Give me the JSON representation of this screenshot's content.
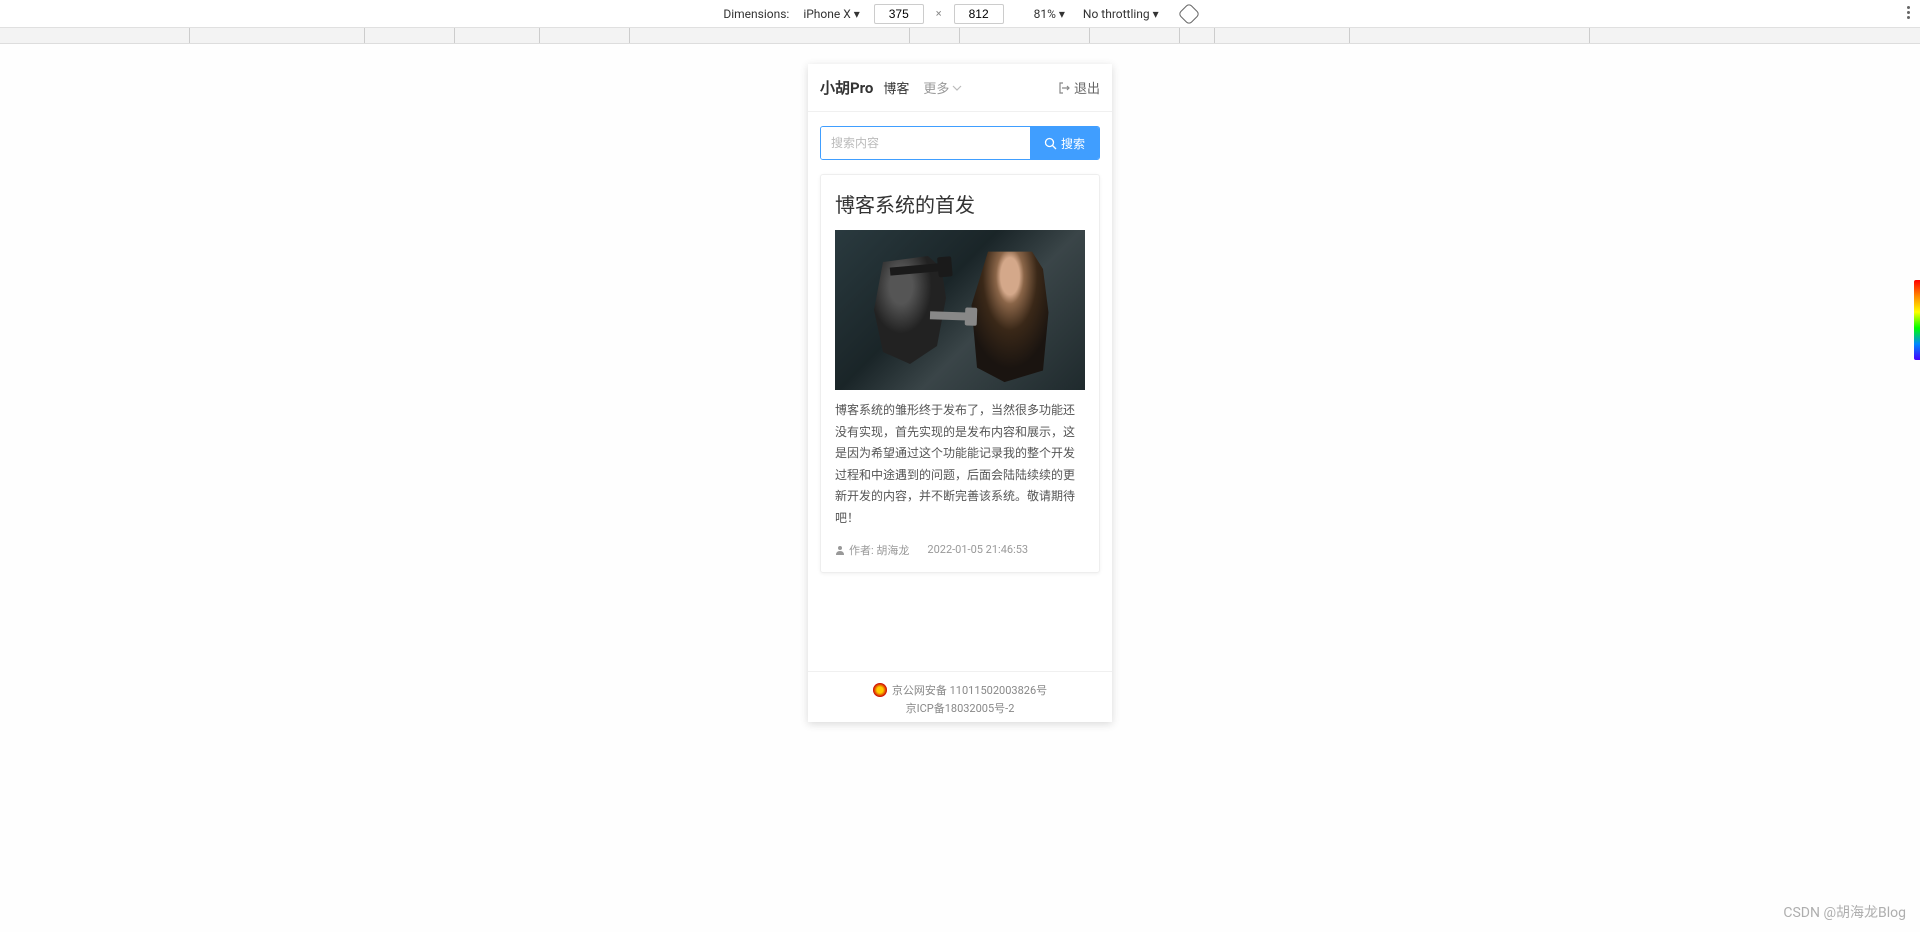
{
  "devtools": {
    "dimensions_label": "Dimensions:",
    "device": "iPhone X ▾",
    "width": "375",
    "height": "812",
    "zoom": "81% ▾",
    "throttling": "No throttling ▾"
  },
  "app": {
    "logo": "小胡Pro",
    "nav": {
      "blog": "博客",
      "more": "更多"
    },
    "logout": "退出",
    "search": {
      "placeholder": "搜索内容",
      "button": "搜索"
    },
    "post": {
      "title": "博客系统的首发",
      "excerpt": "博客系统的雏形终于发布了，当然很多功能还没有实现，首先实现的是发布内容和展示，这是因为希望通过这个功能能记录我的整个开发过程和中途遇到的问题，后面会陆陆续续的更新开发的内容，并不断完善该系统。敬请期待吧！",
      "author_label": "作者: 胡海龙",
      "date": "2022-01-05 21:46:53"
    },
    "footer": {
      "line1": "京公网安备 11011502003826号",
      "line2": "京ICP备18032005号-2"
    }
  },
  "watermark": "CSDN @胡海龙Blog"
}
